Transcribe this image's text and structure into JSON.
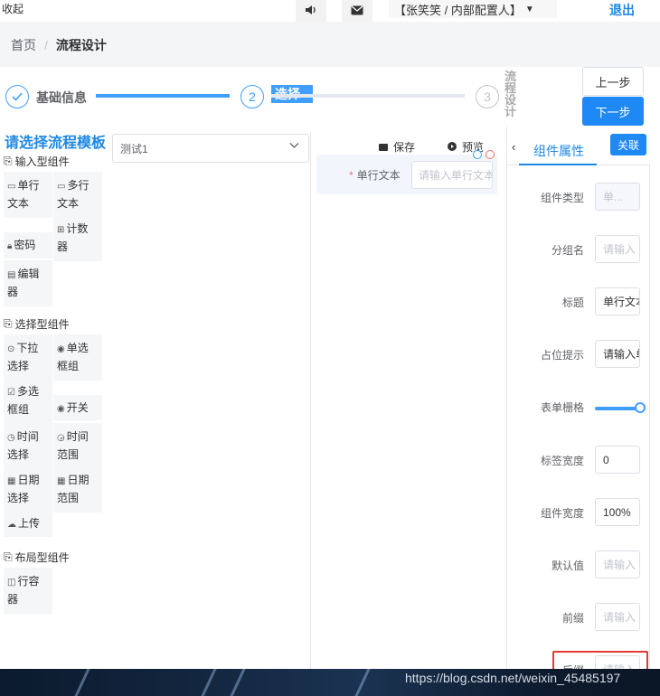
{
  "header": {
    "collapse_label": "收起",
    "user_label": "【张笑笑 / 内部配置人】",
    "logout_label": "退出"
  },
  "breadcrumb": {
    "home": "首页",
    "separator": "/",
    "current": "流程设计"
  },
  "steps": {
    "step1": {
      "number": "1",
      "title": "基础信息",
      "icon": "check-icon"
    },
    "step2": {
      "number": "2",
      "title": "选择"
    },
    "step3": {
      "number": "3",
      "title": "流程设计"
    },
    "prev_label": "上一步",
    "next_label": "下一步"
  },
  "left": {
    "title": "请选择流程模板",
    "groups": [
      {
        "title": "输入型组件",
        "items": [
          {
            "label": "单行文本",
            "icon": "input-icon"
          },
          {
            "label": "多行文本",
            "icon": "textarea-icon"
          },
          {
            "label": "密码",
            "icon": "lock-icon"
          },
          {
            "label": "计数器",
            "icon": "counter-icon"
          },
          {
            "label": "编辑器",
            "icon": "editor-icon"
          }
        ]
      },
      {
        "title": "选择型组件",
        "items": [
          {
            "label": "下拉选择",
            "icon": "select-icon"
          },
          {
            "label": "单选框组",
            "icon": "radio-icon"
          },
          {
            "label": "多选框组",
            "icon": "checkbox-icon"
          },
          {
            "label": "开关",
            "icon": "switch-icon"
          },
          {
            "label": "时间选择",
            "icon": "clock-icon"
          },
          {
            "label": "时间范围",
            "icon": "time-range-icon"
          },
          {
            "label": "日期选择",
            "icon": "calendar-icon"
          },
          {
            "label": "日期范围",
            "icon": "date-range-icon"
          },
          {
            "label": "上传",
            "icon": "upload-icon"
          }
        ]
      },
      {
        "title": "布局型组件",
        "items": [
          {
            "label": "行容器",
            "icon": "row-container-icon"
          }
        ]
      }
    ]
  },
  "template_select": {
    "value": "测试1"
  },
  "canvas": {
    "save_label": "保存",
    "preview_label": "预览",
    "field_label": "单行文本",
    "field_placeholder": "请输入单行文本"
  },
  "right_panel": {
    "tab_label": "组件属性",
    "link_label": "关联",
    "props": [
      {
        "label": "组件类型",
        "value": "单...",
        "kind": "disabled"
      },
      {
        "label": "分组名",
        "value": "请输入",
        "kind": "placeholder"
      },
      {
        "label": "标题",
        "value": "单行文本",
        "kind": "filled"
      },
      {
        "label": "占位提示",
        "value": "请输入单行文本",
        "kind": "filled"
      },
      {
        "label": "表单栅格",
        "value": "",
        "kind": "slider"
      },
      {
        "label": "标签宽度",
        "value": "0",
        "kind": "filled"
      },
      {
        "label": "组件宽度",
        "value": "100%",
        "kind": "filled"
      },
      {
        "label": "默认值",
        "value": "请输入",
        "kind": "placeholder"
      },
      {
        "label": "前缀",
        "value": "请输入",
        "kind": "placeholder"
      },
      {
        "label": "后缀",
        "value": "请输入",
        "kind": "placeholder"
      }
    ],
    "form_grid_value": 24,
    "form_grid_max": 24
  },
  "watermark": "https://blog.csdn.net/weixin_45485197"
}
